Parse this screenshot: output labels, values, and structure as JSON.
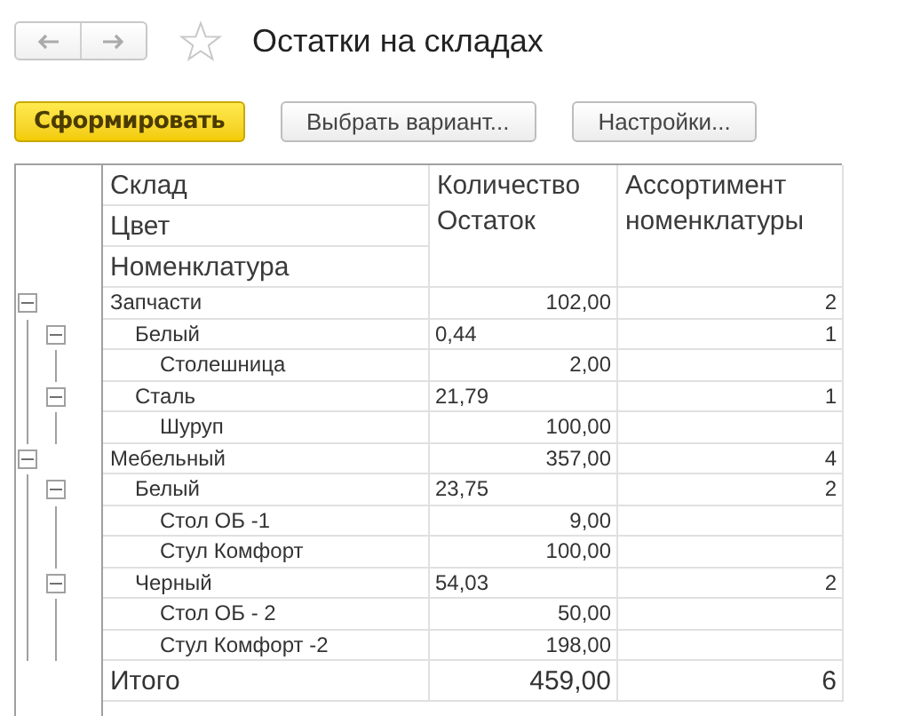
{
  "title": "Остатки на складах",
  "toolbar": [
    {
      "label": "Сформировать",
      "kind": "primary"
    },
    {
      "label": "Выбрать вариант..."
    },
    {
      "label": "Настройки..."
    }
  ],
  "report": {
    "header": [
      [
        "Склад",
        "Цвет",
        "Номенклатура"
      ],
      [
        "Количество",
        "Остаток"
      ],
      [
        "Ассортимент",
        "номенклатуры"
      ]
    ],
    "rows": [
      {
        "name": "Запчасти",
        "qty": "102,00",
        "assortment": "2",
        "expanded": true,
        "children": [
          {
            "name": "Белый",
            "qty": "0,44",
            "assortment": "1",
            "expanded": true,
            "children": [
              {
                "name": "Столешница",
                "qty": "2,00"
              }
            ]
          },
          {
            "name": "Сталь",
            "qty": "21,79",
            "assortment": "1",
            "expanded": true,
            "children": [
              {
                "name": "Шуруп",
                "qty": "100,00"
              }
            ]
          }
        ]
      },
      {
        "name": "Мебельный",
        "qty": "357,00",
        "assortment": "4",
        "expanded": true,
        "children": [
          {
            "name": "Белый",
            "qty": "23,75",
            "assortment": "2",
            "expanded": true,
            "children": [
              {
                "name": "Стол ОБ -1",
                "qty": "9,00"
              },
              {
                "name": "Стул Комфорт",
                "qty": "100,00"
              }
            ]
          },
          {
            "name": "Черный",
            "qty": "54,03",
            "assortment": "2",
            "expanded": true,
            "children": [
              {
                "name": "Стол ОБ - 2",
                "qty": "50,00"
              },
              {
                "name": "Стул Комфорт -2",
                "qty": "198,00"
              }
            ]
          }
        ]
      }
    ],
    "total": {
      "label": "Итого",
      "qty": "459,00",
      "assortment": "6"
    }
  }
}
